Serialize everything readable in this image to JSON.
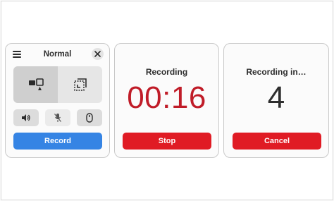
{
  "panels": {
    "normal": {
      "title": "Normal",
      "record_label": "Record",
      "modes": [
        "screen-capture-icon",
        "selection-capture-icon"
      ],
      "toggles": [
        "audio-icon",
        "microphone-muted-icon",
        "pointer-icon"
      ]
    },
    "recording": {
      "title": "Recording",
      "timer": "00:16",
      "stop_label": "Stop"
    },
    "countdown": {
      "title": "Recording in…",
      "count": "4",
      "cancel_label": "Cancel"
    }
  },
  "colors": {
    "accent_blue": "#3584e4",
    "destructive_red": "#e01b24",
    "timer_red": "#c01c28"
  }
}
